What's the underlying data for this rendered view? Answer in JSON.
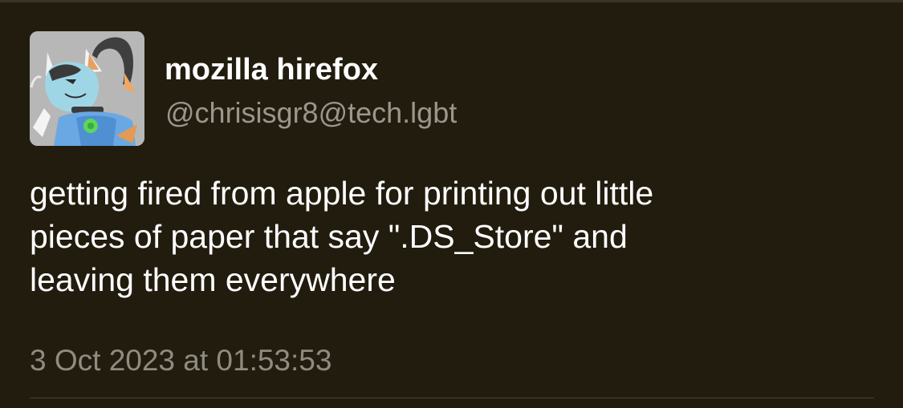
{
  "post": {
    "author": {
      "display_name": "mozilla hirefox",
      "handle": "@chrisisgr8@tech.lgbt",
      "avatar_icon": "fox-character-avatar"
    },
    "text_lines": [
      "getting fired from apple for printing out little",
      "pieces of paper that say \".DS_Store\" and",
      "leaving them everywhere"
    ],
    "timestamp": "3 Oct 2023 at 01:53:53"
  },
  "colors": {
    "background": "#221c0f",
    "primary_text": "#ffffff",
    "secondary_text": "#9a968c",
    "divider": "#4a4535"
  }
}
